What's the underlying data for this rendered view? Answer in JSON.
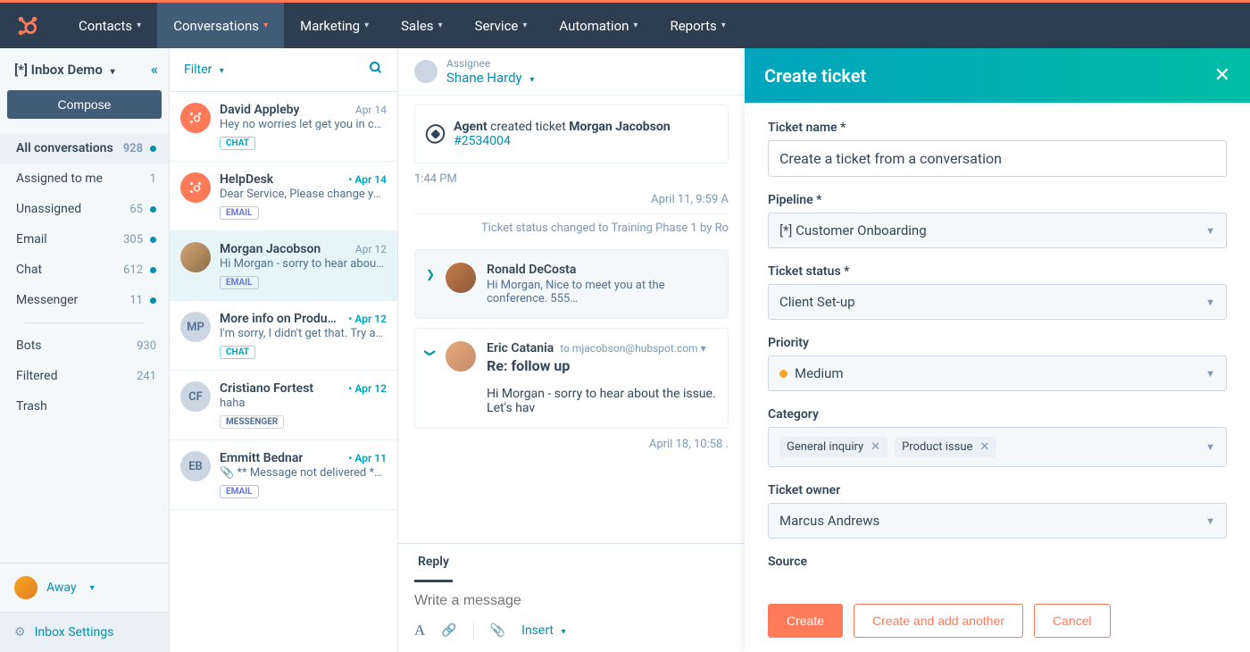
{
  "nav": {
    "items": [
      "Contacts",
      "Conversations",
      "Marketing",
      "Sales",
      "Service",
      "Automation",
      "Reports"
    ],
    "active_index": 1
  },
  "sidebar": {
    "title": "[*] Inbox Demo",
    "compose": "Compose",
    "views": [
      {
        "label": "All conversations",
        "count": "928",
        "dot": true,
        "sel": true
      },
      {
        "label": "Assigned to me",
        "count": "1",
        "dot": false
      },
      {
        "label": "Unassigned",
        "count": "65",
        "dot": true
      },
      {
        "label": "Email",
        "count": "305",
        "dot": true
      },
      {
        "label": "Chat",
        "count": "612",
        "dot": true
      },
      {
        "label": "Messenger",
        "count": "11",
        "dot": true
      }
    ],
    "views2": [
      {
        "label": "Bots",
        "count": "930"
      },
      {
        "label": "Filtered",
        "count": "241"
      },
      {
        "label": "Trash",
        "count": ""
      }
    ],
    "status": "Away",
    "settings": "Inbox Settings"
  },
  "list": {
    "filter": "Filter",
    "items": [
      {
        "name": "David Appleby",
        "date": "Apr 14",
        "new": false,
        "preview": "Hey no worries let get you in cont…",
        "badge": "CHAT",
        "av": "hub",
        "sel": false
      },
      {
        "name": "HelpDesk",
        "date": "Apr 14",
        "new": true,
        "preview": "Dear Service, Please change your…",
        "badge": "EMAIL",
        "av": "hub",
        "sel": false
      },
      {
        "name": "Morgan Jacobson",
        "date": "Apr 12",
        "new": false,
        "preview": "Hi Morgan - sorry to hear about th…",
        "badge": "EMAIL",
        "av": "img",
        "sel": true
      },
      {
        "name": "More info on Produ…",
        "date": "Apr 12",
        "new": true,
        "preview": "I'm sorry, I didn't get that. Try aga…",
        "badge": "CHAT",
        "av": "MP",
        "sel": false
      },
      {
        "name": "Cristiano Fortest",
        "date": "Apr 12",
        "new": true,
        "preview": "haha",
        "badge": "MESSENGER",
        "av": "CF",
        "sel": false
      },
      {
        "name": "Emmitt Bednar",
        "date": "Apr 11",
        "new": true,
        "preview": "📎 ** Message not delivered ** Y…",
        "badge": "EMAIL",
        "av": "EB",
        "sel": false
      }
    ]
  },
  "thread": {
    "assignee_label": "Assignee",
    "assignee": "Shane Hardy",
    "sys_agent": "Agent",
    "sys_text": " created ticket ",
    "sys_name": "Morgan Jacobson",
    "sys_ticket": "#2534004",
    "time1": "1:44 PM",
    "date1": "April 11, 9:59 A",
    "status_change": "Ticket status changed to Training Phase 1 by Ro",
    "msg1_from": "Ronald DeCosta",
    "msg1_text": "Hi Morgan, Nice to meet you at the conference. 555…",
    "msg2_from": "Eric Catania",
    "msg2_to": "to mjacobson@hubspot.com",
    "msg2_subj": "Re: follow up",
    "msg2_body": "Hi Morgan - sorry to hear about the issue. Let's hav",
    "date2": "April 18, 10:58 .",
    "reply_tab": "Reply",
    "composer_ph": "Write a message",
    "insert": "Insert"
  },
  "panel": {
    "title": "Create ticket",
    "f_name_label": "Ticket name *",
    "f_name_value": "Create a ticket from a conversation",
    "f_pipeline_label": "Pipeline *",
    "f_pipeline_value": "[*] Customer Onboarding",
    "f_status_label": "Ticket status *",
    "f_status_value": "Client Set-up",
    "f_priority_label": "Priority",
    "f_priority_value": "Medium",
    "f_category_label": "Category",
    "f_category_tags": [
      "General inquiry",
      "Product issue"
    ],
    "f_owner_label": "Ticket owner",
    "f_owner_value": "Marcus Andrews",
    "f_source_label": "Source",
    "btn_create": "Create",
    "btn_another": "Create and add another",
    "btn_cancel": "Cancel"
  }
}
